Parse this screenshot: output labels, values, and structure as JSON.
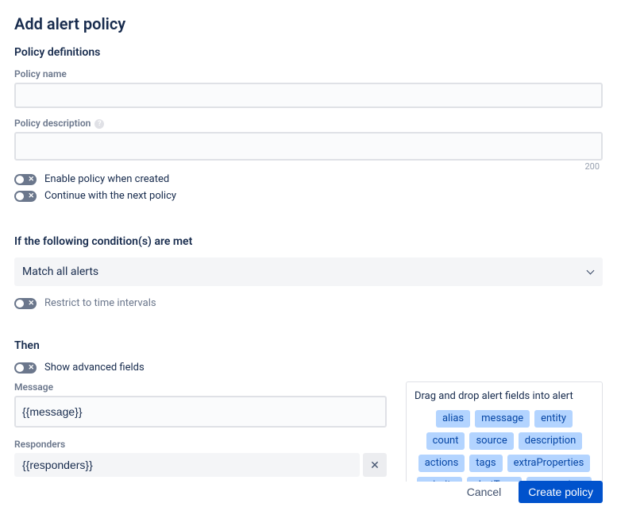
{
  "title": "Add alert policy",
  "sections": {
    "definitions": "Policy definitions",
    "conditions": "If the following condition(s) are met",
    "then": "Then"
  },
  "labels": {
    "policy_name": "Policy name",
    "policy_description": "Policy description",
    "message": "Message",
    "responders": "Responders"
  },
  "values": {
    "policy_name": "",
    "policy_description": "",
    "desc_remaining": "200",
    "condition_selected": "Match all alerts",
    "message": "{{message}}",
    "responders": "{{responders}}"
  },
  "toggles": {
    "enable_policy": "Enable policy when created",
    "continue_next": "Continue with the next policy",
    "restrict_time": "Restrict to time intervals",
    "show_advanced": "Show advanced fields"
  },
  "fields_panel": {
    "title": "Drag and drop alert fields into alert",
    "pills": [
      "alias",
      "message",
      "entity",
      "count",
      "source",
      "description",
      "actions",
      "tags",
      "extraProperties",
      "priority",
      "alertType",
      "responders"
    ]
  },
  "footer": {
    "cancel": "Cancel",
    "create": "Create policy"
  }
}
